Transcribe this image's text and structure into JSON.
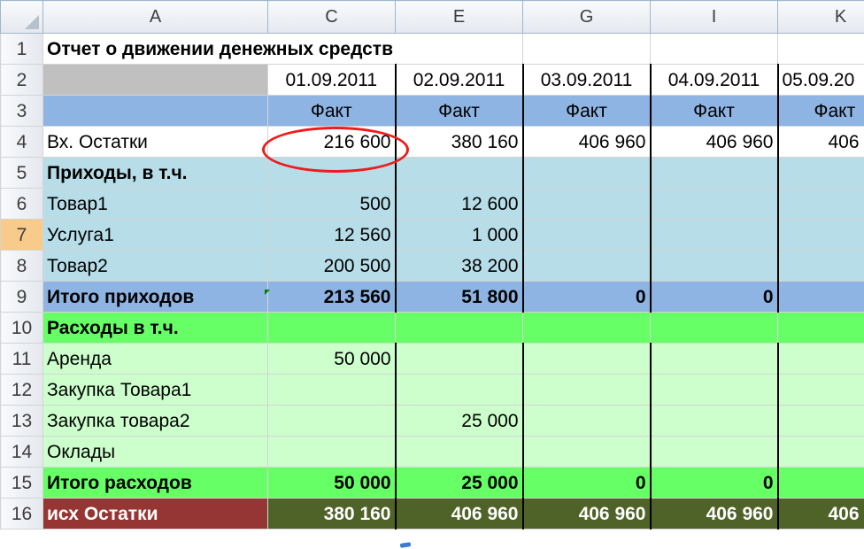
{
  "columns": [
    "A",
    "C",
    "E",
    "G",
    "I",
    "K"
  ],
  "rows": [
    {
      "n": "1",
      "a": "Отчет о движении денежных средств (ДДС)",
      "v": [
        "",
        "",
        "",
        "",
        ""
      ]
    },
    {
      "n": "2",
      "a": "",
      "v": [
        "01.09.2011",
        "02.09.2011",
        "03.09.2011",
        "04.09.2011",
        "05.09.20"
      ]
    },
    {
      "n": "3",
      "a": "",
      "v": [
        "Факт",
        "Факт",
        "Факт",
        "Факт",
        "Факт"
      ]
    },
    {
      "n": "4",
      "a": "Вх. Остатки",
      "v": [
        "216 600",
        "380 160",
        "406 960",
        "406 960",
        "406"
      ]
    },
    {
      "n": "5",
      "a": "Приходы, в т.ч.",
      "v": [
        "",
        "",
        "",
        "",
        ""
      ]
    },
    {
      "n": "6",
      "a": "Товар1",
      "v": [
        "500",
        "12 600",
        "",
        "",
        ""
      ]
    },
    {
      "n": "7",
      "a": "Услуга1",
      "v": [
        "12 560",
        "1 000",
        "",
        "",
        ""
      ]
    },
    {
      "n": "8",
      "a": "Товар2",
      "v": [
        "200 500",
        "38 200",
        "",
        "",
        ""
      ]
    },
    {
      "n": "9",
      "a": "Итого приходов",
      "v": [
        "213 560",
        "51 800",
        "0",
        "0",
        ""
      ]
    },
    {
      "n": "10",
      "a": "Расходы в т.ч.",
      "v": [
        "",
        "",
        "",
        "",
        ""
      ]
    },
    {
      "n": "11",
      "a": "Аренда",
      "v": [
        "50 000",
        "",
        "",
        "",
        ""
      ]
    },
    {
      "n": "12",
      "a": "Закупка Товара1",
      "v": [
        "",
        "",
        "",
        "",
        ""
      ]
    },
    {
      "n": "13",
      "a": "Закупка товара2",
      "v": [
        "",
        "25 000",
        "",
        "",
        ""
      ]
    },
    {
      "n": "14",
      "a": "Оклады",
      "v": [
        "",
        "",
        "",
        "",
        ""
      ]
    },
    {
      "n": "15",
      "a": "Итого расходов",
      "v": [
        "50 000",
        "25 000",
        "0",
        "0",
        ""
      ]
    },
    {
      "n": "16",
      "a": "исх Остатки",
      "v": [
        "380 160",
        "406 960",
        "406 960",
        "406 960",
        "406"
      ]
    }
  ],
  "colors": {
    "header_fact": "#8db4e2",
    "income": "#b7dde8",
    "expense_header": "#66ff66",
    "expense_items": "#ccffcc",
    "end_balance_label": "#963634",
    "end_balance_values": "#4f6228",
    "highlight_ellipse": "#ee1c1c",
    "selected_row_header": "#f8cb8a"
  },
  "selected_row": "7"
}
